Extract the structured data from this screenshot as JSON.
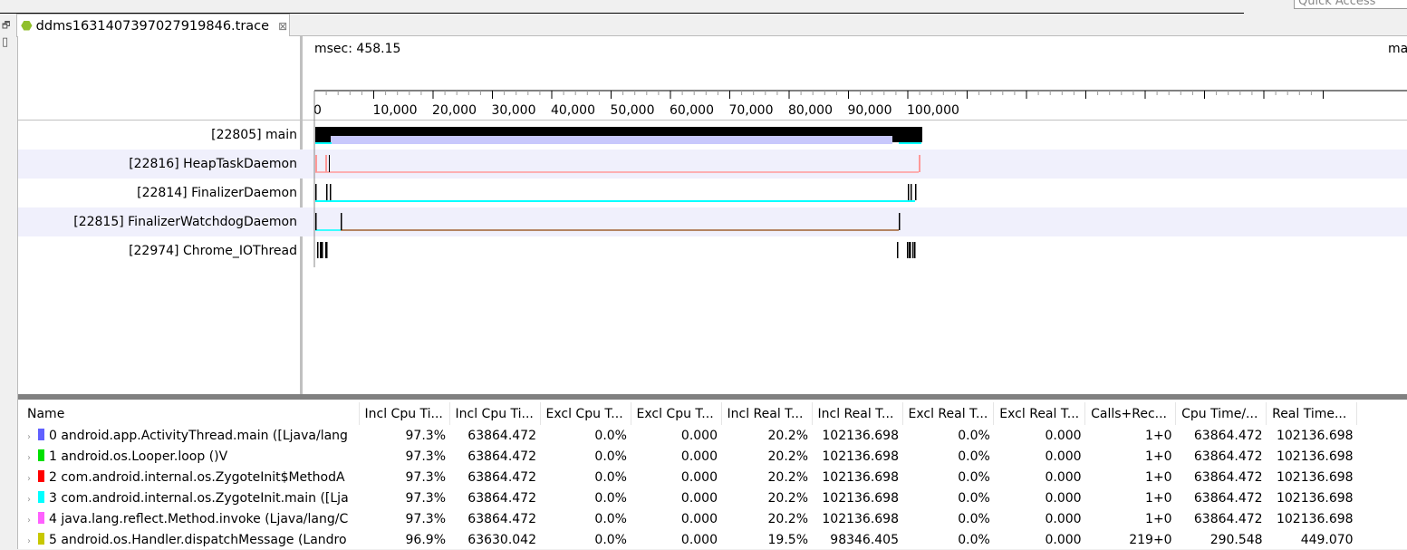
{
  "quick_access": "Quick Access",
  "tab": {
    "title": "ddms1631407397027919846.trace",
    "close": "⊠"
  },
  "timeline": {
    "msec_label": "msec: 458.15",
    "max_label": "ma",
    "ticks": [
      "0",
      "10,000",
      "20,000",
      "30,000",
      "40,000",
      "50,000",
      "60,000",
      "70,000",
      "80,000",
      "90,000",
      "100,000"
    ],
    "threads": [
      {
        "label": "[22805] main"
      },
      {
        "label": "[22816] HeapTaskDaemon"
      },
      {
        "label": "[22814] FinalizerDaemon"
      },
      {
        "label": "[22815] FinalizerWatchdogDaemon"
      },
      {
        "label": "[22974] Chrome_IOThread"
      }
    ]
  },
  "table": {
    "headers": [
      "Name",
      "Incl Cpu Ti...",
      "Incl Cpu Ti...",
      "Excl Cpu T...",
      "Excl Cpu T...",
      "Incl Real T...",
      "Incl Real T...",
      "Excl Real T...",
      "Excl Real T...",
      "Calls+Rec...",
      "Cpu Time/...",
      "Real Time..."
    ],
    "rows": [
      {
        "color": "#6060ff",
        "name": "0 android.app.ActivityThread.main ([Ljava/lang",
        "cells": [
          "97.3%",
          "63864.472",
          "0.0%",
          "0.000",
          "20.2%",
          "102136.698",
          "0.0%",
          "0.000",
          "1+0",
          "63864.472",
          "102136.698"
        ]
      },
      {
        "color": "#00e000",
        "name": "1 android.os.Looper.loop ()V",
        "cells": [
          "97.3%",
          "63864.472",
          "0.0%",
          "0.000",
          "20.2%",
          "102136.698",
          "0.0%",
          "0.000",
          "1+0",
          "63864.472",
          "102136.698"
        ]
      },
      {
        "color": "#ff0000",
        "name": "2 com.android.internal.os.ZygoteInit$MethodA",
        "cells": [
          "97.3%",
          "63864.472",
          "0.0%",
          "0.000",
          "20.2%",
          "102136.698",
          "0.0%",
          "0.000",
          "1+0",
          "63864.472",
          "102136.698"
        ]
      },
      {
        "color": "#00ffff",
        "name": "3 com.android.internal.os.ZygoteInit.main ([Lja",
        "cells": [
          "97.3%",
          "63864.472",
          "0.0%",
          "0.000",
          "20.2%",
          "102136.698",
          "0.0%",
          "0.000",
          "1+0",
          "63864.472",
          "102136.698"
        ]
      },
      {
        "color": "#ff60ff",
        "name": "4 java.lang.reflect.Method.invoke (Ljava/lang/C",
        "cells": [
          "97.3%",
          "63864.472",
          "0.0%",
          "0.000",
          "20.2%",
          "102136.698",
          "0.0%",
          "0.000",
          "1+0",
          "63864.472",
          "102136.698"
        ]
      },
      {
        "color": "#c8c800",
        "name": "5 android.os.Handler.dispatchMessage (Landro",
        "cells": [
          "96.9%",
          "63630.042",
          "0.0%",
          "0.000",
          "19.5%",
          "98346.405",
          "0.0%",
          "0.000",
          "219+0",
          "290.548",
          "449.070"
        ]
      }
    ]
  }
}
